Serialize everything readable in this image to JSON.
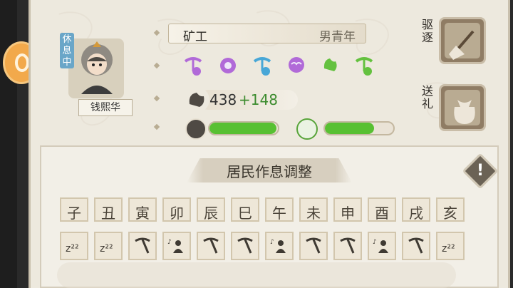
{
  "resident": {
    "name": "钱熙华",
    "status_tag": "休息中",
    "job": "矿工",
    "demographic": "男青年",
    "strength_base": "438",
    "strength_bonus": "+148",
    "health_fraction": 0.98,
    "mood_fraction": 0.72
  },
  "actions": {
    "expel_label": "驱逐",
    "gift_label": "送礼"
  },
  "schedule": {
    "title": "居民作息调整",
    "hours": [
      "子",
      "丑",
      "寅",
      "卯",
      "辰",
      "巳",
      "午",
      "未",
      "申",
      "酉",
      "戌",
      "亥"
    ],
    "activities": [
      "sleep",
      "sleep",
      "work",
      "rest",
      "work",
      "work",
      "rest",
      "work",
      "work",
      "rest",
      "work",
      "sleep"
    ]
  },
  "colors": {
    "bar_fill": "#58c032",
    "trait_purple": "#b16ad8",
    "trait_blue": "#48a7d7",
    "trait_green": "#64c13f"
  }
}
